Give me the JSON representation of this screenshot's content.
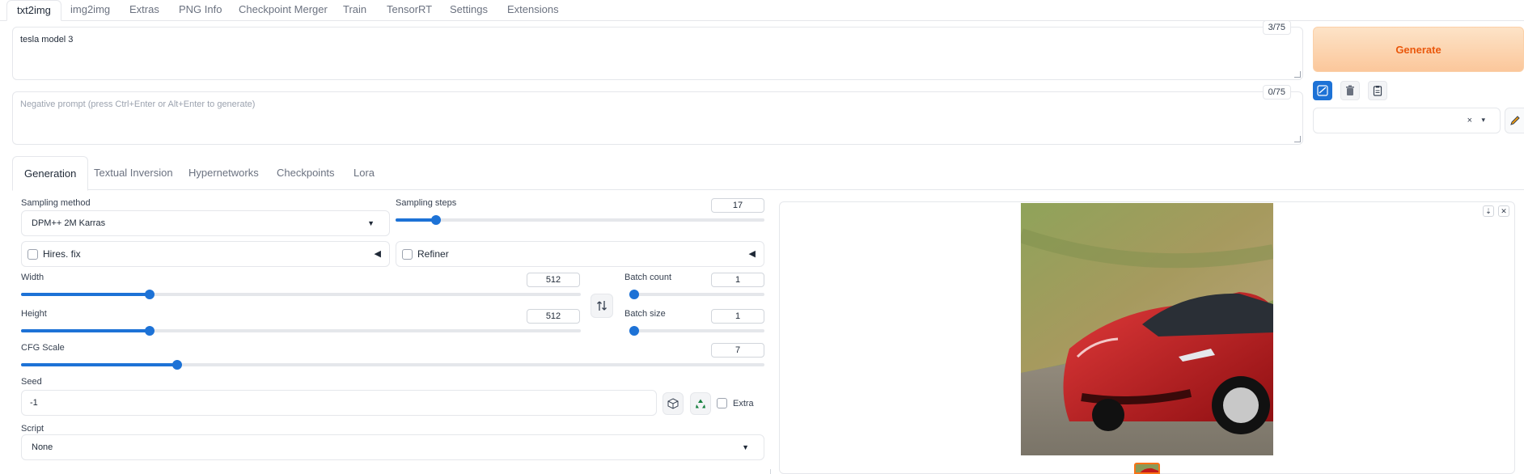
{
  "top_tabs": [
    {
      "label": "txt2img",
      "active": true
    },
    {
      "label": "img2img"
    },
    {
      "label": "Extras"
    },
    {
      "label": "PNG Info"
    },
    {
      "label": "Checkpoint Merger"
    },
    {
      "label": "Train"
    },
    {
      "label": "TensorRT"
    },
    {
      "label": "Settings"
    },
    {
      "label": "Extensions"
    }
  ],
  "prompt": {
    "value": "tesla model 3",
    "token_count": "3/75"
  },
  "negative_prompt": {
    "placeholder": "Negative prompt (press Ctrl+Enter or Alt+Enter to generate)",
    "token_count": "0/75"
  },
  "generate": {
    "label": "Generate"
  },
  "tools": {
    "icons": [
      "checkbox-icon",
      "trash-icon",
      "clipboard-icon",
      "pencil-icon"
    ]
  },
  "styles": {
    "clear": "×",
    "caret": "▾"
  },
  "sub_tabs": [
    {
      "label": "Generation",
      "active": true
    },
    {
      "label": "Textual Inversion"
    },
    {
      "label": "Hypernetworks"
    },
    {
      "label": "Checkpoints"
    },
    {
      "label": "Lora"
    }
  ],
  "sampling_method": {
    "label": "Sampling method",
    "value": "DPM++ 2M Karras"
  },
  "sampling_steps": {
    "label": "Sampling steps",
    "value": "17",
    "fraction": 0.11
  },
  "hires_fix": {
    "label": "Hires. fix",
    "arrow": "◀"
  },
  "refiner": {
    "label": "Refiner",
    "arrow": "◀"
  },
  "width": {
    "label": "Width",
    "value": "512",
    "fraction": 0.23
  },
  "height": {
    "label": "Height",
    "value": "512",
    "fraction": 0.23
  },
  "batch_count": {
    "label": "Batch count",
    "value": "1",
    "fraction": 0.0
  },
  "batch_size": {
    "label": "Batch size",
    "value": "1",
    "fraction": 0.0
  },
  "cfg_scale": {
    "label": "CFG Scale",
    "value": "7",
    "fraction": 0.21
  },
  "seed": {
    "label": "Seed",
    "value": "-1",
    "extra_label": "Extra"
  },
  "script": {
    "label": "Script",
    "value": "None"
  },
  "output": {
    "download_icon": "⇣",
    "close_icon": "✕"
  },
  "colors": {
    "accent": "#1d72d6",
    "generate_text": "#ea580c",
    "generate_bg": "#fbc79b",
    "car_red": "#c21a1a"
  }
}
